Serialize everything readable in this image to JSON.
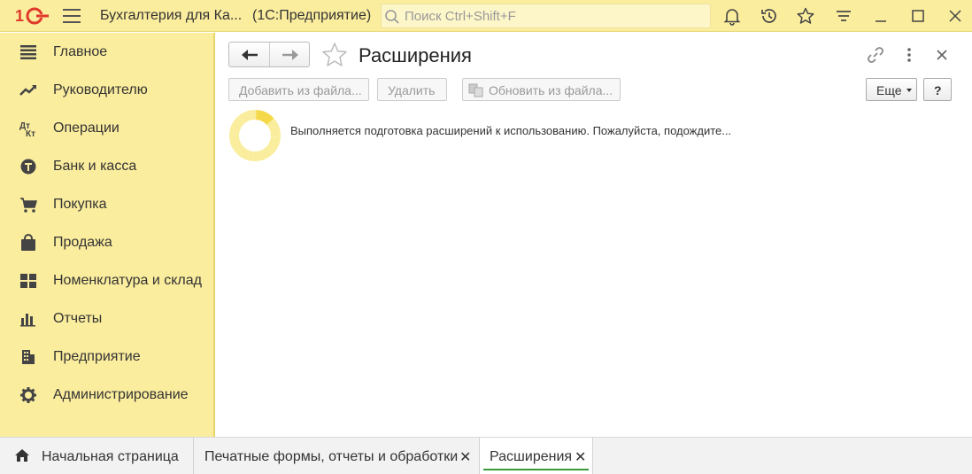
{
  "topbar": {
    "app_title": "Бухгалтерия для Ка...",
    "app_subtitle": "(1С:Предприятие)",
    "search_placeholder": "Поиск Ctrl+Shift+F"
  },
  "sidebar": {
    "items": [
      {
        "label": "Главное",
        "icon": "list-icon"
      },
      {
        "label": "Руководителю",
        "icon": "trend-chart-icon"
      },
      {
        "label": "Операции",
        "icon": "operations-icon"
      },
      {
        "label": "Банк и касса",
        "icon": "bank-icon"
      },
      {
        "label": "Покупка",
        "icon": "cart-icon"
      },
      {
        "label": "Продажа",
        "icon": "shopping-bag-icon"
      },
      {
        "label": "Номенклатура и склад",
        "icon": "grid-icon"
      },
      {
        "label": "Отчеты",
        "icon": "bar-chart-icon"
      },
      {
        "label": "Предприятие",
        "icon": "building-icon"
      },
      {
        "label": "Администрирование",
        "icon": "gear-icon"
      }
    ]
  },
  "form": {
    "title": "Расширения",
    "buttons": {
      "add_from_file": "Добавить из файла...",
      "delete": "Удалить",
      "update_from_file": "Обновить из файла...",
      "more": "Еще",
      "help": "?"
    },
    "message": "Выполняется подготовка расширений к использованию. Пожалуйста, подождите..."
  },
  "tabs": [
    {
      "label": "Начальная страница"
    },
    {
      "label": "Печатные формы, отчеты и обработки",
      "close": "✕"
    },
    {
      "label": "Расширения",
      "close": "✕"
    }
  ],
  "colors": {
    "panel_yellow": "#fbed9e",
    "accent_green": "#3a9a3a",
    "logo_red": "#e03a2a"
  }
}
